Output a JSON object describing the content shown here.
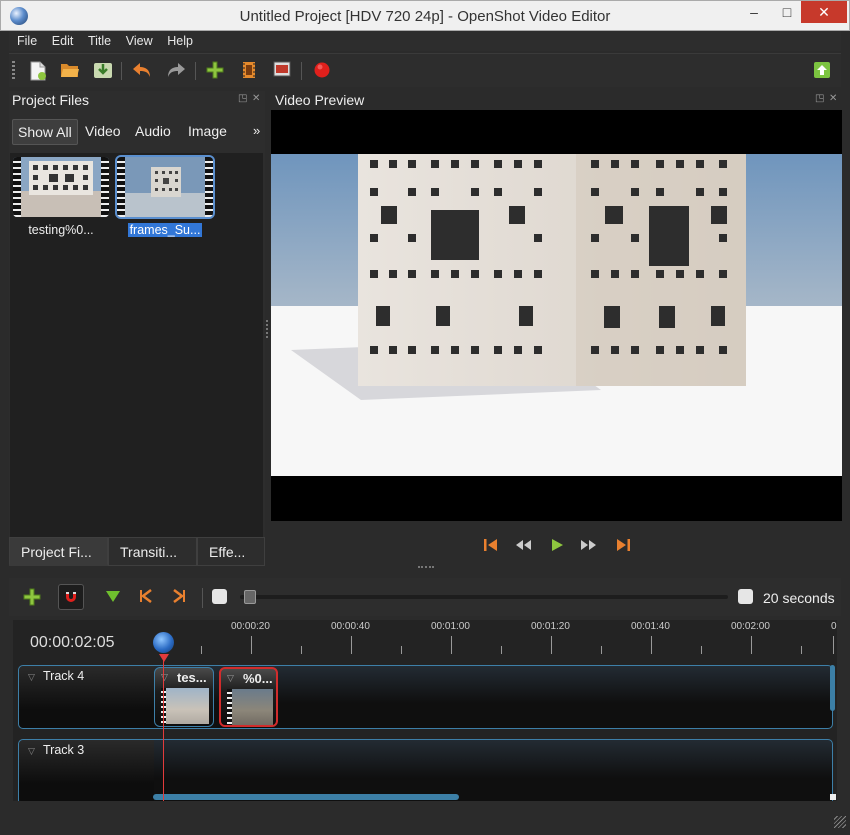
{
  "window": {
    "title": "Untitled Project [HDV 720 24p] - OpenShot Video Editor",
    "minimize": "–",
    "maximize": "□",
    "close": "✕"
  },
  "menu": [
    "File",
    "Edit",
    "Title",
    "View",
    "Help"
  ],
  "toolbar": {
    "icons": [
      "new-project-icon",
      "open-project-icon",
      "save-project-icon",
      "undo-icon",
      "redo-icon",
      "import-files-icon",
      "choose-profile-icon",
      "fullscreen-icon",
      "export-record-icon",
      "update-available-icon"
    ]
  },
  "project_files": {
    "title": "Project Files",
    "filters": [
      "Show All",
      "Video",
      "Audio",
      "Image"
    ],
    "more": "»",
    "files": [
      {
        "label": "testing%0...",
        "selected": false
      },
      {
        "label": "frames_Su...",
        "selected": true
      }
    ],
    "bottom_tabs": [
      "Project Fi...",
      "Transiti...",
      "Effe..."
    ]
  },
  "preview": {
    "title": "Video Preview"
  },
  "playback": {
    "icons": [
      "jump-start-icon",
      "rewind-icon",
      "play-icon",
      "fast-forward-icon",
      "jump-end-icon"
    ]
  },
  "timeline": {
    "zoom_label": "20 seconds",
    "current_time": "00:00:02:05",
    "ticks": [
      "00:00:20",
      "00:00:40",
      "00:01:00",
      "00:01:20",
      "00:01:40",
      "00:02:00",
      "0"
    ],
    "tracks": [
      {
        "name": "Track 4",
        "clips": [
          {
            "title": "tes..."
          },
          {
            "title": "%0..."
          }
        ]
      },
      {
        "name": "Track 3",
        "clips": []
      }
    ]
  },
  "colors": {
    "accent": "#3c7fa6",
    "playhead": "#e23b3b",
    "selection": "#3277d7"
  }
}
